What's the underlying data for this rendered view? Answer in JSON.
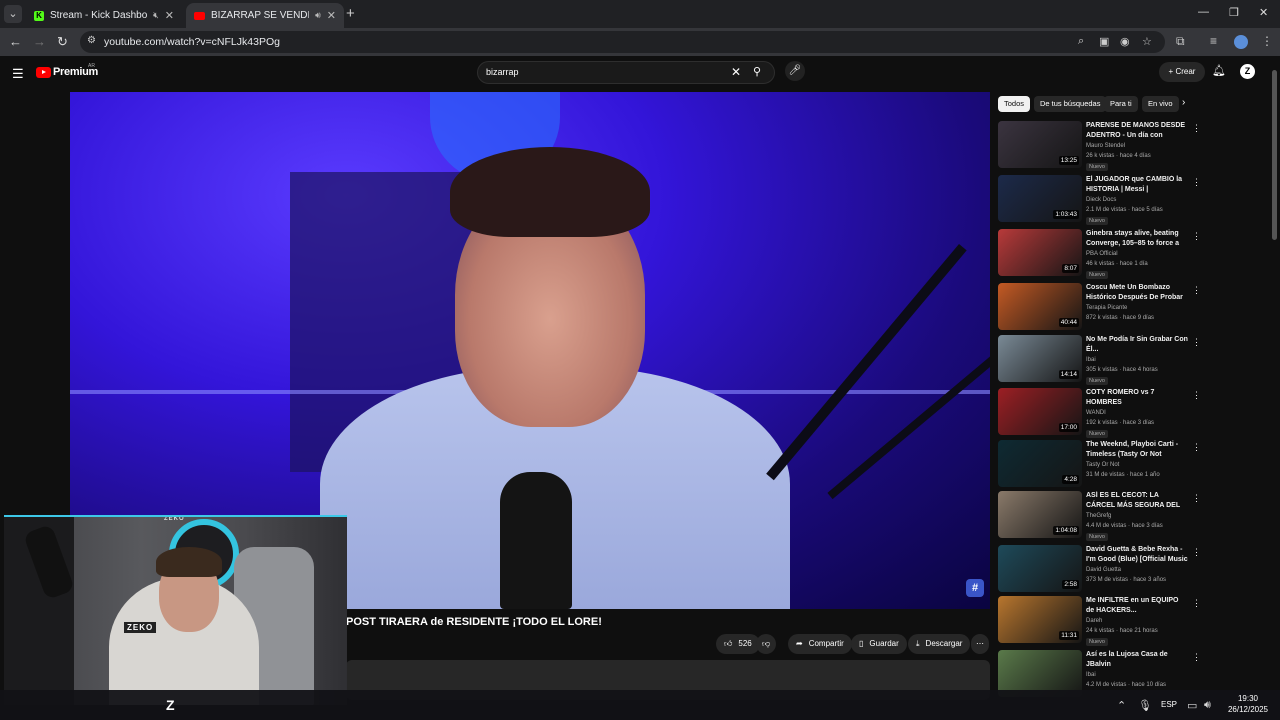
{
  "browser": {
    "tabs": [
      {
        "title": "Stream - Kick Dashboard",
        "favicon": "kick-icon"
      },
      {
        "title": "BIZARRAP SE VENDIÓ? ANÁLISIS",
        "favicon": "youtube-icon"
      }
    ],
    "url": "youtube.com/watch?v=cNFLJk43POg"
  },
  "youtube": {
    "brand": "Premium",
    "country": "AR",
    "search_value": "bizarrap",
    "create_label": "Crear",
    "avatar_letter": "Z"
  },
  "video": {
    "title": "POST TIRAERA de RESIDENTE ¡TODO EL LORE!",
    "likes": "526",
    "share_label": "Compartir",
    "save_label": "Guardar",
    "download_label": "Descargar",
    "watermark": "#"
  },
  "chips": [
    "Todos",
    "De tus búsquedas",
    "Para ti",
    "En vivo"
  ],
  "recommendations": [
    {
      "title": "PARENSE DE MANOS DESDE ADENTRO - Un día con Maurito",
      "channel": "Mauro Stendel",
      "meta": "26 k vistas · hace 4 días",
      "duration": "13:25",
      "badge": "Nuevo",
      "thumb": "#3b3440"
    },
    {
      "title": "El JUGADOR que CAMBIÓ la HISTORIA | Messi | Documental",
      "channel": "Dieck Docs",
      "meta": "2.1 M de vistas · hace 5 días",
      "duration": "1:03:43",
      "badge": "Nuevo",
      "thumb": "#1c2a4a"
    },
    {
      "title": "Ginebra stays alive, beating Converge, 105–85 to force a d...",
      "channel": "PBA Official",
      "meta": "46 k vistas · hace 1 día",
      "duration": "8:07",
      "badge": "Nuevo",
      "thumb": "#b83a3a"
    },
    {
      "title": "Coscu Mete Un Bombazo Histórico Después De Probar ...",
      "channel": "Terapia Picante",
      "meta": "872 k vistas · hace 9 días",
      "duration": "40:44",
      "badge": "",
      "thumb": "#c45a24"
    },
    {
      "title": "No Me Podía Ir Sin Grabar Con Él...",
      "channel": "Ibai",
      "meta": "305 k vistas · hace 4 horas",
      "duration": "14:14",
      "badge": "Nuevo",
      "thumb": "#7a8a96"
    },
    {
      "title": "COTY ROMERO vs 7 HOMBRES",
      "channel": "WANDI",
      "meta": "192 k vistas · hace 3 días",
      "duration": "17:00",
      "badge": "Nuevo",
      "thumb": "#9c1f24"
    },
    {
      "title": "The Weeknd, Playboi Carti - Timeless (Tasty Or Not Remix)...",
      "channel": "Tasty Or Not",
      "meta": "31 M de vistas · hace 1 año",
      "duration": "4:28",
      "badge": "",
      "thumb": "#0e2a33"
    },
    {
      "title": "ASÍ ES EL CECOT: LA CÁRCEL MÁS SEGURA DEL MUNDO",
      "channel": "TheGrefg",
      "meta": "4.4 M de vistas · hace 3 días",
      "duration": "1:04:08",
      "badge": "Nuevo",
      "thumb": "#8a7a6a"
    },
    {
      "title": "David Guetta & Bebe Rexha - I'm Good (Blue) [Official Music ...",
      "channel": "David Guetta",
      "meta": "373 M de vistas · hace 3 años",
      "duration": "2:58",
      "badge": "",
      "thumb": "#1e4a5a"
    },
    {
      "title": "Me INFILTRE en un EQUIPO de HACKERS...",
      "channel": "Dareh",
      "meta": "24 k vistas · hace 21 horas",
      "duration": "11:31",
      "badge": "Nuevo",
      "thumb": "#b8762e"
    },
    {
      "title": "Así es la Lujosa Casa de JBalvin",
      "channel": "Ibai",
      "meta": "4.2 M de vistas · hace 10 días",
      "duration": "",
      "badge": "",
      "thumb": "#5a7a4a"
    }
  ],
  "webcam": {
    "label": "ZEKO",
    "sign": "ZEKO"
  },
  "taskbar": {
    "lang": "ESP",
    "time": "19:30",
    "date": "26/12/2025"
  }
}
